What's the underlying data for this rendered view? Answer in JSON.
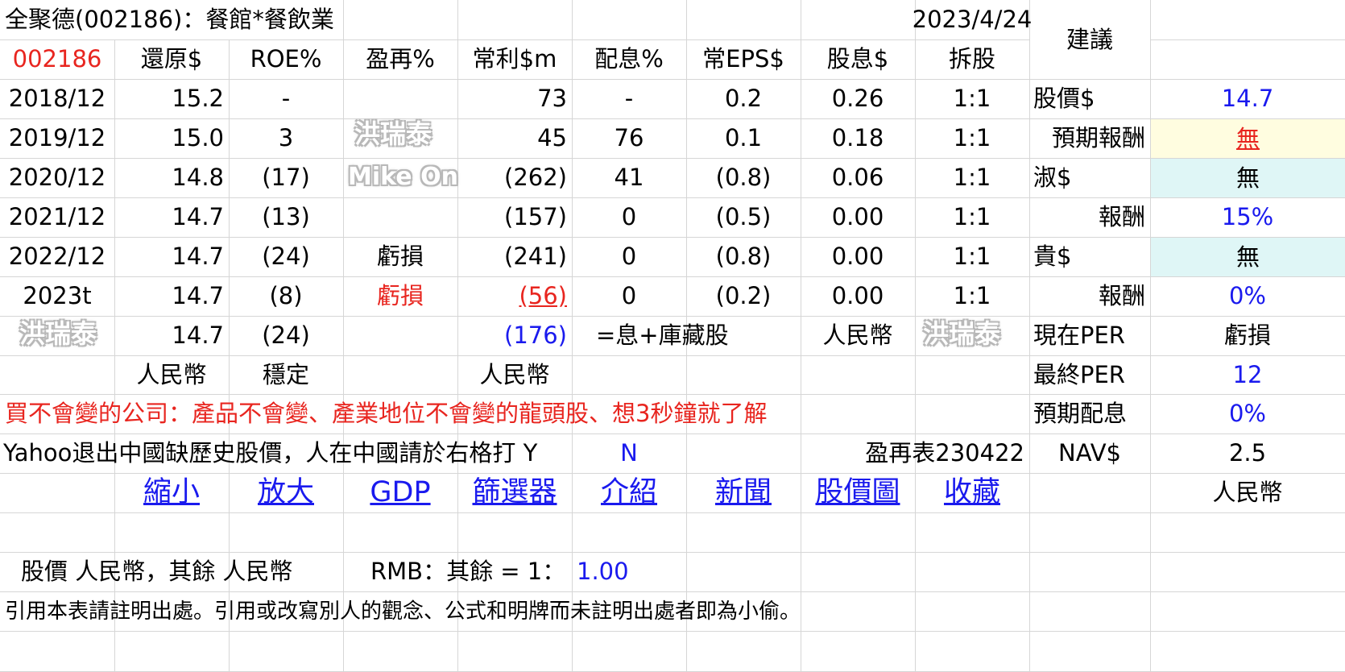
{
  "title": "全聚德(002186)：餐館*餐飲業",
  "date": "2023/4/24",
  "advice_label": "建議",
  "headers": [
    "002186",
    "還原$",
    "ROE%",
    "盈再%",
    "常利$m",
    "配息%",
    "常EPS$",
    "股息$",
    "拆股"
  ],
  "rows": [
    [
      "2018/12",
      "15.2",
      "-",
      "",
      "73",
      "-",
      "0.2",
      "0.26",
      "1:1"
    ],
    [
      "2019/12",
      "15.0",
      "3",
      "",
      "45",
      "76",
      "0.1",
      "0.18",
      "1:1"
    ],
    [
      "2020/12",
      "14.8",
      "(17)",
      "",
      "(262)",
      "41",
      "(0.8)",
      "0.06",
      "1:1"
    ],
    [
      "2021/12",
      "14.7",
      "(13)",
      "",
      "(157)",
      "0",
      "(0.5)",
      "0.00",
      "1:1"
    ],
    [
      "2022/12",
      "14.7",
      "(24)",
      "虧損",
      "(241)",
      "0",
      "(0.8)",
      "0.00",
      "1:1"
    ],
    [
      "2023t",
      "14.7",
      "(8)",
      "虧損",
      "(56)",
      "0",
      "(0.2)",
      "0.00",
      "1:1"
    ]
  ],
  "summary_row": {
    "adj_price": "14.7",
    "roe": "(24)",
    "profit": "(176)",
    "payout_note": "=息+庫藏股",
    "currency": "人民幣"
  },
  "unit_row": {
    "adj_price": "人民幣",
    "roe": "穩定",
    "profit": "人民幣"
  },
  "side_panel": [
    {
      "label": "股價$",
      "value": "14.7"
    },
    {
      "label": "預期報酬",
      "value": "無"
    },
    {
      "label": "淑$",
      "value": "無"
    },
    {
      "label": "報酬",
      "value": "15%"
    },
    {
      "label": "貴$",
      "value": "無"
    },
    {
      "label": "報酬",
      "value": "0%"
    },
    {
      "label": "現在PER",
      "value": "虧損"
    },
    {
      "label": "最終PER",
      "value": "12"
    },
    {
      "label": "預期配息",
      "value": "0%"
    },
    {
      "label": "NAV$",
      "value": "2.5"
    }
  ],
  "side_currency": "人民幣",
  "motto": "買不會變的公司：產品不會變、產業地位不會變的龍頭股、想3秒鐘就了解",
  "yahoo_note": "Yahoo退出中國缺歷史股價，人在中國請於右格打 Y",
  "yahoo_value": "N",
  "sheet_version": "盈再表230422",
  "links": [
    "縮小",
    "放大",
    "GDP",
    "篩選器",
    "介紹",
    "新聞",
    "股價圖",
    "收藏"
  ],
  "currency_note": "股價 人民幣，其餘 人民幣",
  "rmb_label": "RMB：其餘 = 1：",
  "rmb_rate": "1.00",
  "footer": "引用本表請註明出處。引用或改寫別人的觀念、公式和明牌而未註明出處者即為小偷。",
  "watermarks": [
    "洪瑞泰",
    "Mike On",
    "洪瑞泰",
    "洪瑞泰"
  ],
  "colors": {
    "red": "#e8251f",
    "blue": "#1a1aee",
    "yellow": "#fffde0",
    "cyan": "#dff6f6",
    "grid": "#d6d6d6"
  }
}
